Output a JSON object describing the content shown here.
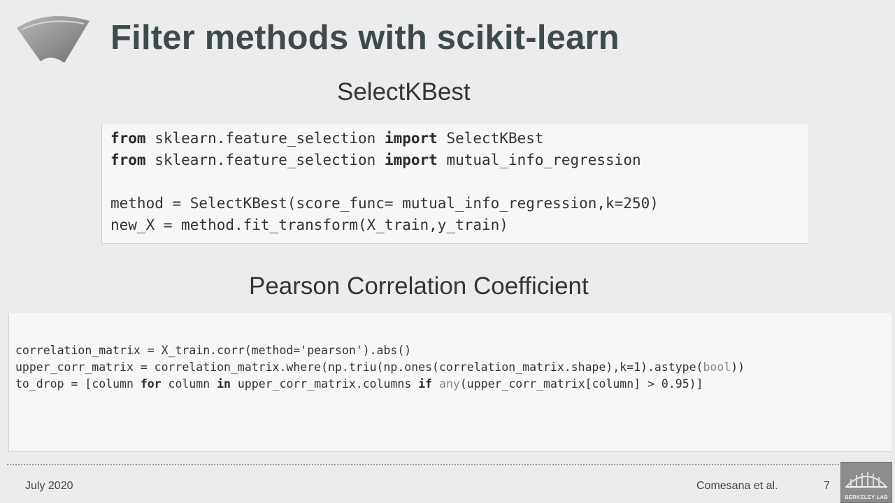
{
  "slide": {
    "title": "Filter methods with scikit-learn",
    "logo_icon": "funnel-shape-icon"
  },
  "section1": {
    "heading": "SelectKBest",
    "code": [
      [
        [
          "kw",
          "from"
        ],
        [
          "t",
          " sklearn.feature_selection "
        ],
        [
          "kw",
          "import"
        ],
        [
          "t",
          " SelectKBest"
        ]
      ],
      [
        [
          "kw",
          "from"
        ],
        [
          "t",
          " sklearn.feature_selection "
        ],
        [
          "kw",
          "import"
        ],
        [
          "t",
          " mutual_info_regression"
        ]
      ],
      [],
      [
        [
          "t",
          "method = SelectKBest(score_func= mutual_info_regression,k=250)"
        ]
      ],
      [
        [
          "t",
          "new_X = method.fit_transform(X_train,y_train)"
        ]
      ]
    ]
  },
  "section2": {
    "heading": "Pearson Correlation Coefficient",
    "code": [
      [
        [
          "t",
          "correlation_matrix = X_train.corr(method='pearson').abs()"
        ]
      ],
      [
        [
          "t",
          "upper_corr_matrix = correlation_matrix.where(np.triu(np.ones(correlation_matrix.shape),k=1).astype("
        ],
        [
          "mute",
          "bool"
        ],
        [
          "t",
          "))"
        ]
      ],
      [
        [
          "t",
          "to_drop = [column "
        ],
        [
          "kw",
          "for"
        ],
        [
          "t",
          " column "
        ],
        [
          "kw",
          "in"
        ],
        [
          "t",
          " upper_corr_matrix.columns "
        ],
        [
          "kw",
          "if"
        ],
        [
          "t",
          " "
        ],
        [
          "mute",
          "any"
        ],
        [
          "t",
          "(upper_corr_matrix[column] > 0.95)]"
        ]
      ]
    ]
  },
  "footer": {
    "date": "July 2020",
    "author": "Comesana et al.",
    "page": "7",
    "lab_logo_text": "BERKELEY LAB"
  }
}
